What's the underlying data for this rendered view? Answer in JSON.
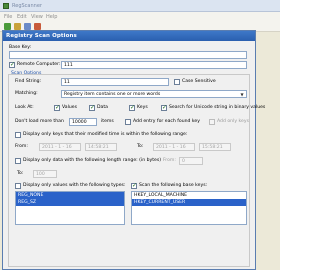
{
  "app": {
    "title": "RegScanner",
    "menu": [
      "File",
      "Edit",
      "View",
      "Help"
    ]
  },
  "dialog": {
    "title": "Registry Scan Options",
    "base_key_label": "Base Key:",
    "base_key_value": "",
    "remote_computer_label": "Remote Computer:",
    "remote_computer_value": "111",
    "scan_options_label": "Scan Options",
    "find_string_label": "Find String:",
    "find_string_value": "11",
    "case_sensitive_label": "Case Sensitive",
    "matching_label": "Matching:",
    "matching_value": "Registry item contains one or more words",
    "look_at_label": "Look At:",
    "values_label": "Values",
    "data_label": "Data",
    "keys_label": "Keys",
    "unicode_label": "Search for Unicode string in binary values",
    "dont_load_label": "Don't load more than",
    "dont_load_value": "10000",
    "items_label": "items",
    "add_entry_label": "Add entry for each found key",
    "add_only_keys_label": "Add only keys",
    "modified_time_label": "Display only keys that their modified time is within the following range:",
    "from_label": "From:",
    "to_label": "To:",
    "from_date": "2011 - 1 - 16",
    "from_time": "14:58:21",
    "to_date": "2011 - 1 - 16",
    "to_time": "15:58:21",
    "length_range_label": "Display only data with the following length range: (in bytes)",
    "length_from_label": "From:",
    "length_from_value": "0",
    "length_to_label": "To:",
    "length_to_value": "100",
    "value_types_label": "Display only values with the following types:",
    "value_types": [
      "REG_NONE",
      "REG_SZ"
    ],
    "scan_base_keys_label": "Scan the following base keys:",
    "base_keys": [
      "HKEY_LOCAL_MACHINE",
      "HKEY_CURRENT_USER"
    ]
  }
}
